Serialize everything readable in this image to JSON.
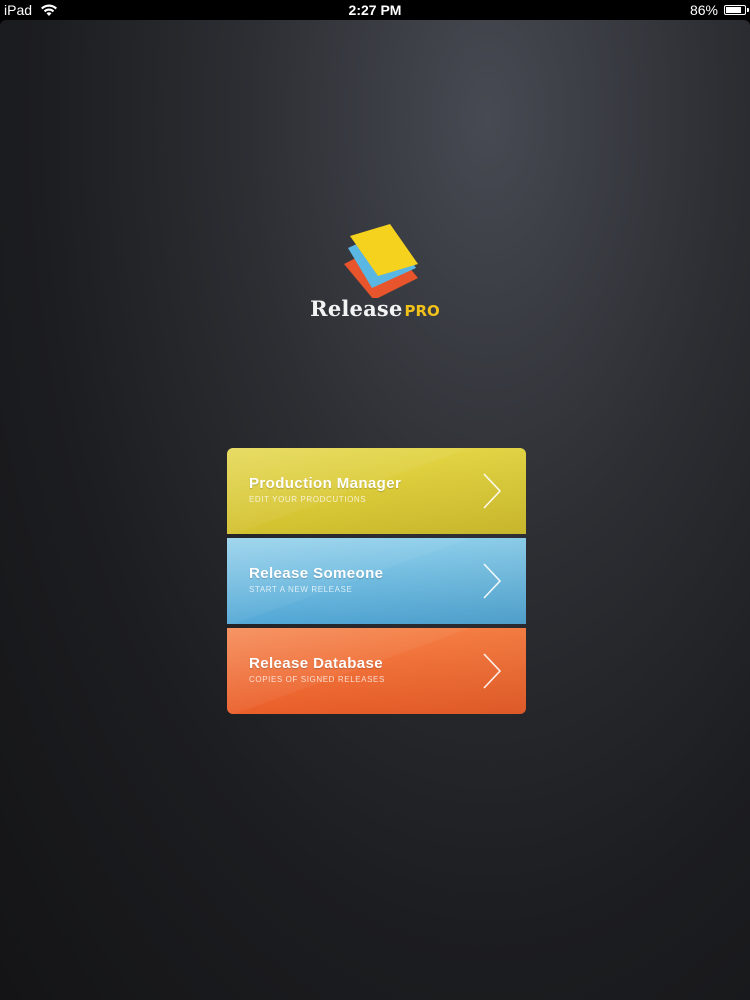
{
  "status_bar": {
    "carrier": "iPad",
    "time": "2:27 PM",
    "battery_percent": "86%",
    "battery_level": 0.86
  },
  "logo": {
    "word": "Release",
    "suffix": "PRO",
    "colors": {
      "yellow": "#f4d21e",
      "blue": "#5ab6e2",
      "orange": "#e8542b",
      "pro": "#f2c21b"
    }
  },
  "menu": {
    "items": [
      {
        "title": "Production Manager",
        "subtitle": "EDIT YOUR PRODCUTIONS",
        "color": "#d9c935",
        "icon": "chevron-right-icon"
      },
      {
        "title": "Release Someone",
        "subtitle": "START A NEW RELEASE",
        "color": "#6ab8de",
        "icon": "chevron-right-icon"
      },
      {
        "title": "Release Database",
        "subtitle": "COPIES OF SIGNED RELEASES",
        "color": "#ef6a33",
        "icon": "chevron-right-icon"
      }
    ]
  }
}
